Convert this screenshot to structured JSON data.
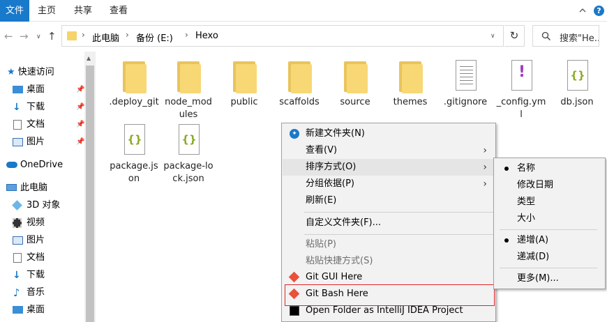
{
  "ribbon": {
    "file_tab": "文件",
    "tabs": [
      "主页",
      "共享",
      "查看"
    ],
    "help": "?"
  },
  "address": {
    "crumbs": [
      "此电脑",
      "备份 (E:)",
      "Hexo"
    ],
    "search_placeholder": "搜索\"He..."
  },
  "sidebar": {
    "quick_access": "快速访问",
    "quick_items": [
      "桌面",
      "下载",
      "文档",
      "图片"
    ],
    "onedrive": "OneDrive",
    "this_pc": "此电脑",
    "pc_items": [
      "3D 对象",
      "视频",
      "图片",
      "文档",
      "下载",
      "音乐",
      "桌面"
    ]
  },
  "files": [
    {
      "name": ".deploy_git",
      "type": "folder"
    },
    {
      "name": "node_modules",
      "type": "folder"
    },
    {
      "name": "public",
      "type": "folder"
    },
    {
      "name": "scaffolds",
      "type": "folder"
    },
    {
      "name": "source",
      "type": "folder"
    },
    {
      "name": "themes",
      "type": "folder"
    },
    {
      "name": ".gitignore",
      "type": "text"
    },
    {
      "name": "_config.yml",
      "type": "yml"
    },
    {
      "name": "db.json",
      "type": "json"
    },
    {
      "name": "package.json",
      "type": "json"
    },
    {
      "name": "package-lock.json",
      "type": "json"
    }
  ],
  "context_menu": {
    "new_folder": "新建文件夹(N)",
    "view": "查看(V)",
    "sort_by": "排序方式(O)",
    "group_by": "分组依据(P)",
    "refresh": "刷新(E)",
    "customize": "自定义文件夹(F)...",
    "paste": "粘贴(P)",
    "paste_shortcut": "粘贴快捷方式(S)",
    "git_gui": "Git GUI Here",
    "git_bash": "Git Bash Here",
    "intellij": "Open Folder as IntelliJ IDEA Project"
  },
  "sort_submenu": {
    "name": "名称",
    "date_modified": "修改日期",
    "type": "类型",
    "size": "大小",
    "ascending": "递增(A)",
    "descending": "递减(D)",
    "more": "更多(M)..."
  },
  "colors": {
    "accent": "#1979ca",
    "folder": "#f8d775",
    "highlight_border": "#e0242b"
  }
}
